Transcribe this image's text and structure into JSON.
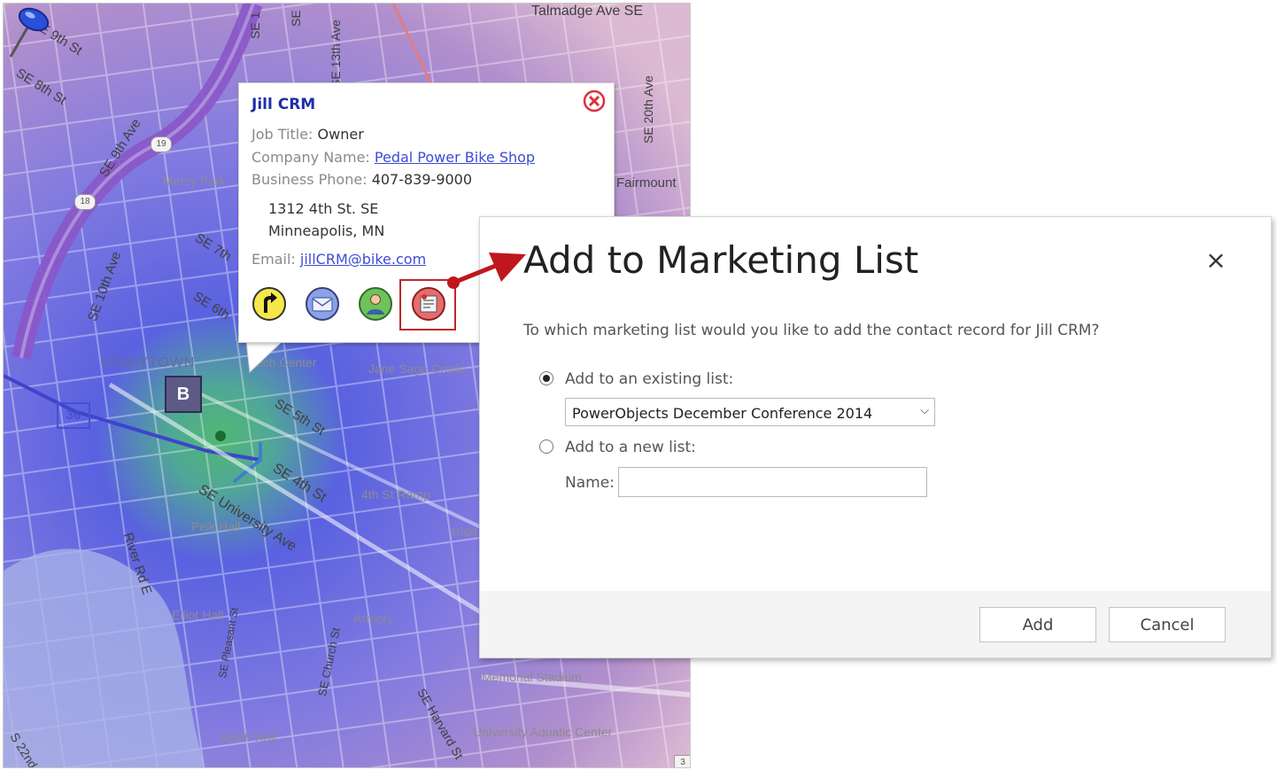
{
  "map": {
    "streets": [
      "SE 9th St",
      "SE 8th St",
      "SE 9th Ave",
      "SE 10th Ave",
      "SE 7th",
      "SE 6th",
      "SE 5th St",
      "SE 4th St",
      "SE University Ave",
      "River Rd E",
      "SE Pleasant St",
      "SE Church St",
      "SE Harvard St",
      "SE 13th Ave",
      "SE 20th Ave",
      "Talmadge Ave SE",
      "S 22nd",
      "SE 1",
      "SE"
    ],
    "places": [
      "Marcy Park",
      "DINKYTOWN",
      "Tech Center",
      "Jane Sage Cowle",
      "4th St Ramp",
      "Peik Hall",
      "Elliot Hall",
      "Armory",
      "Ridd Aren",
      "Memorial Stadium",
      "University Aquatic Center",
      "Smith Hall",
      "Fairmount"
    ],
    "highway_shields": [
      "19",
      "18"
    ],
    "route_shields": [
      "36"
    ],
    "marker_label": "B",
    "corner_badge": "3"
  },
  "popup": {
    "name": "Jill CRM",
    "job_title_label": "Job Title:",
    "job_title": "Owner",
    "company_label": "Company Name:",
    "company": "Pedal Power Bike Shop",
    "phone_label": "Business Phone:",
    "phone": "407-839-9000",
    "address_line1": "1312 4th St. SE",
    "address_line2": "Minneapolis, MN",
    "email_label": "Email:",
    "email": "jillCRM@bike.com",
    "action_icons": [
      "directions-icon",
      "email-icon",
      "contact-icon",
      "marketing-list-icon"
    ],
    "icon_colors": [
      "#f7e84a",
      "#8aa2e8",
      "#6cc35a",
      "#e86c6c"
    ]
  },
  "dialog": {
    "title": "Add to Marketing List",
    "close_glyph": "×",
    "question": "To which marketing list would you like to add the contact record for Jill CRM?",
    "existing_option_label": "Add to an existing list:",
    "existing_option_checked": true,
    "selected_list": "PowerObjects December Conference 2014",
    "new_option_label": "Add to a new list:",
    "new_option_checked": false,
    "name_label": "Name:",
    "name_value": "",
    "add_button": "Add",
    "cancel_button": "Cancel"
  },
  "colors": {
    "arrow": "#c0161e",
    "link": "#3d4bd6",
    "title_blue": "#1f2ea8",
    "highlight_box": "#c0262a"
  }
}
